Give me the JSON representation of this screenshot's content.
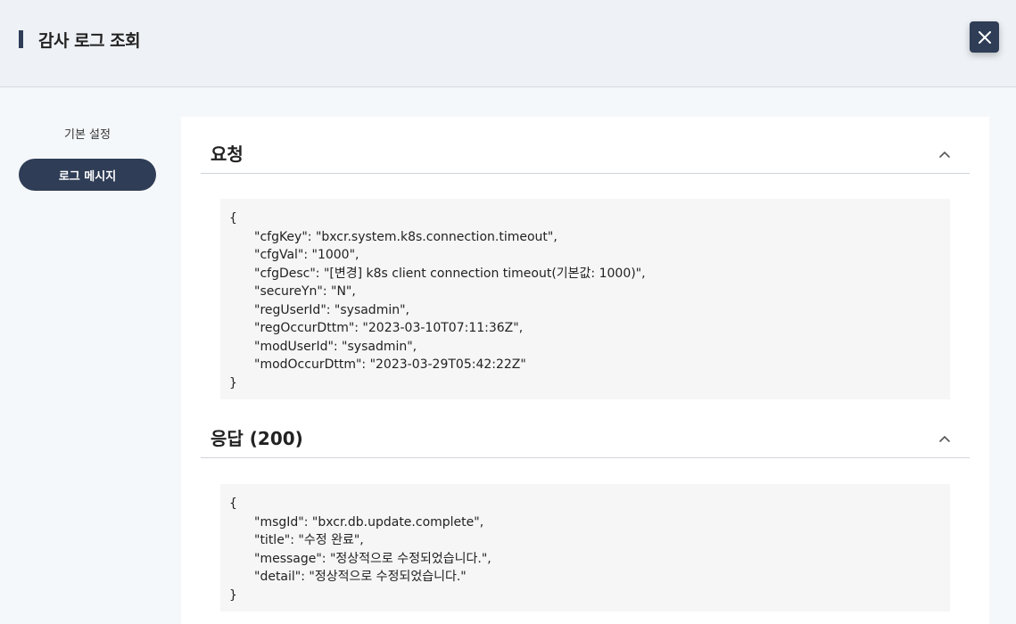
{
  "header": {
    "title": "감사 로그 조회",
    "close_icon": "close-icon"
  },
  "sidebar": {
    "items": [
      {
        "label": "기본 설정",
        "active": false
      },
      {
        "label": "로그 메시지",
        "active": true
      }
    ]
  },
  "sections": {
    "request": {
      "title": "요청",
      "open_brace": "{",
      "close_brace": "}",
      "lines": [
        "\"cfgKey\": \"bxcr.system.k8s.connection.timeout\",",
        "\"cfgVal\": \"1000\",",
        "\"cfgDesc\": \"[변경] k8s client connection timeout(기본값: 1000)\",",
        "\"secureYn\": \"N\",",
        "\"regUserId\": \"sysadmin\",",
        "\"regOccurDttm\": \"2023-03-10T07:11:36Z\",",
        "\"modUserId\": \"sysadmin\",",
        "\"modOccurDttm\": \"2023-03-29T05:42:22Z\""
      ]
    },
    "response": {
      "title": "응답 (200)",
      "open_brace": "{",
      "close_brace": "}",
      "lines": [
        "\"msgId\": \"bxcr.db.update.complete\",",
        "\"title\": \"수정 완료\",",
        "\"message\": \"정상적으로 수정되었습니다.\",",
        "\"detail\": \"정상적으로 수정되었습니다.\""
      ]
    }
  },
  "colors": {
    "primary": "#2f3d56",
    "header_bg": "#eef2f6",
    "page_bg": "#f5f8fb",
    "code_bg": "#f6f6f6"
  }
}
